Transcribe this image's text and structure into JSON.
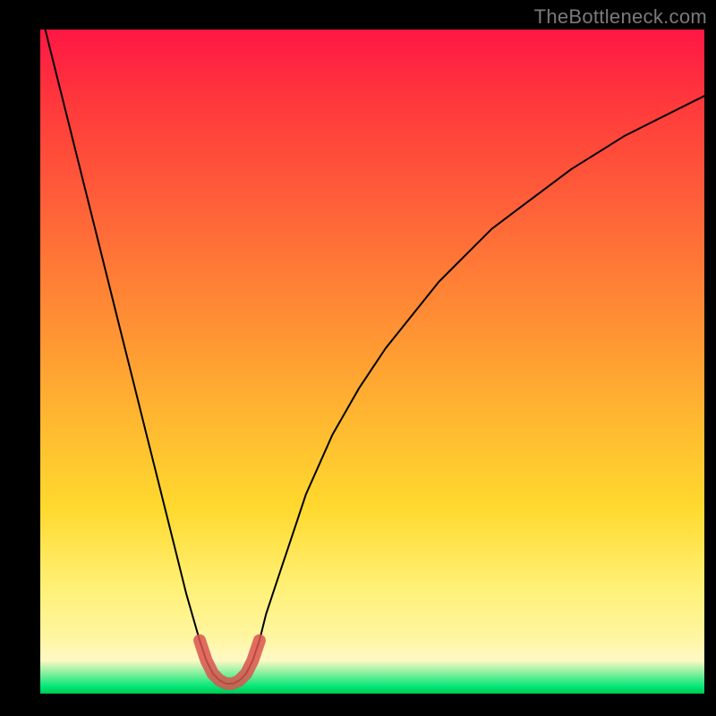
{
  "watermark": "TheBottleneck.com",
  "chart_data": {
    "type": "line",
    "title": "",
    "xlabel": "",
    "ylabel": "",
    "xlim": [
      0,
      100
    ],
    "ylim": [
      0,
      100
    ],
    "x": [
      0,
      2,
      4,
      6,
      8,
      10,
      12,
      14,
      16,
      18,
      20,
      22,
      24,
      25,
      26,
      27,
      28,
      29,
      30,
      31,
      32,
      33,
      34,
      36,
      38,
      40,
      44,
      48,
      52,
      56,
      60,
      64,
      68,
      72,
      76,
      80,
      84,
      88,
      92,
      96,
      100
    ],
    "values": [
      103,
      95,
      87,
      79,
      71,
      63,
      55,
      47,
      39,
      31,
      23,
      15,
      8,
      5,
      3,
      2,
      1.5,
      1.5,
      2,
      3,
      5,
      8,
      12,
      18,
      24,
      30,
      39,
      46,
      52,
      57,
      62,
      66,
      70,
      73,
      76,
      79,
      81.5,
      84,
      86,
      88,
      90
    ],
    "highlight": {
      "color": "#d9534f",
      "x_range": [
        24,
        33
      ]
    },
    "background_gradient": {
      "top": "#ff1744",
      "mid": "#ffd92e",
      "bottom": "#00c853"
    }
  }
}
